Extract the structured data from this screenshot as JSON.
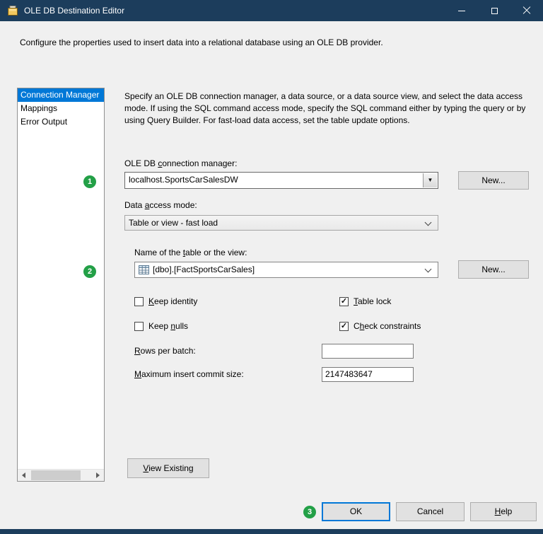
{
  "window": {
    "title": "OLE DB Destination Editor"
  },
  "header": {
    "description": "Configure the properties used to insert data into a relational database using an OLE DB provider."
  },
  "nav": {
    "items": [
      {
        "label": "Connection Manager",
        "selected": true
      },
      {
        "label": "Mappings",
        "selected": false
      },
      {
        "label": "Error Output",
        "selected": false
      }
    ]
  },
  "content": {
    "intro": "Specify an OLE DB connection manager, a data source, or a data source view, and select the data access mode. If using the SQL command access mode, specify the SQL command either by typing the query or by using Query Builder. For fast-load data access, set the table update options.",
    "connection_manager": {
      "label": {
        "pre": "OLE DB ",
        "key": "c",
        "post": "onnection manager:"
      },
      "value": "localhost.SportsCarSalesDW",
      "new_button": "New..."
    },
    "access_mode": {
      "label": {
        "pre": "Data ",
        "key": "a",
        "post": "ccess mode:"
      },
      "value": "Table or view - fast load"
    },
    "table_name": {
      "label": {
        "pre": "Name of the ",
        "key": "t",
        "post": "able or the view:"
      },
      "value": "[dbo].[FactSportsCarSales]",
      "new_button": "New..."
    },
    "options": {
      "keep_identity": {
        "label": {
          "pre": "",
          "key": "K",
          "post": "eep identity"
        },
        "checked": false,
        "mark": ""
      },
      "keep_nulls": {
        "label": {
          "pre": "Keep ",
          "key": "n",
          "post": "ulls"
        },
        "checked": false,
        "mark": ""
      },
      "table_lock": {
        "label": {
          "pre": "",
          "key": "T",
          "post": "able lock"
        },
        "checked": true,
        "mark": "✓"
      },
      "check_constraints": {
        "label": {
          "pre": "C",
          "key": "h",
          "post": "eck constraints"
        },
        "checked": true,
        "mark": "✓"
      }
    },
    "rows_per_batch": {
      "label": {
        "pre": "",
        "key": "R",
        "post": "ows per batch:"
      },
      "value": ""
    },
    "max_commit": {
      "label": {
        "pre": "",
        "key": "M",
        "post": "aximum insert commit size:"
      },
      "value": "2147483647"
    },
    "view_existing_button": {
      "pre": "",
      "key": "V",
      "post": "iew Existing"
    }
  },
  "footer": {
    "ok": "OK",
    "cancel": "Cancel",
    "help": {
      "pre": "",
      "key": "H",
      "post": "elp"
    }
  },
  "annotations": {
    "step1": "1",
    "step2": "2",
    "step3": "3",
    "badge_color": "#23a047"
  },
  "icons": {
    "dropdown_arrow": "▼"
  },
  "colors": {
    "titlebar": "#1c3d5c",
    "selection": "#0078d7",
    "focus_border": "#0078d7"
  }
}
